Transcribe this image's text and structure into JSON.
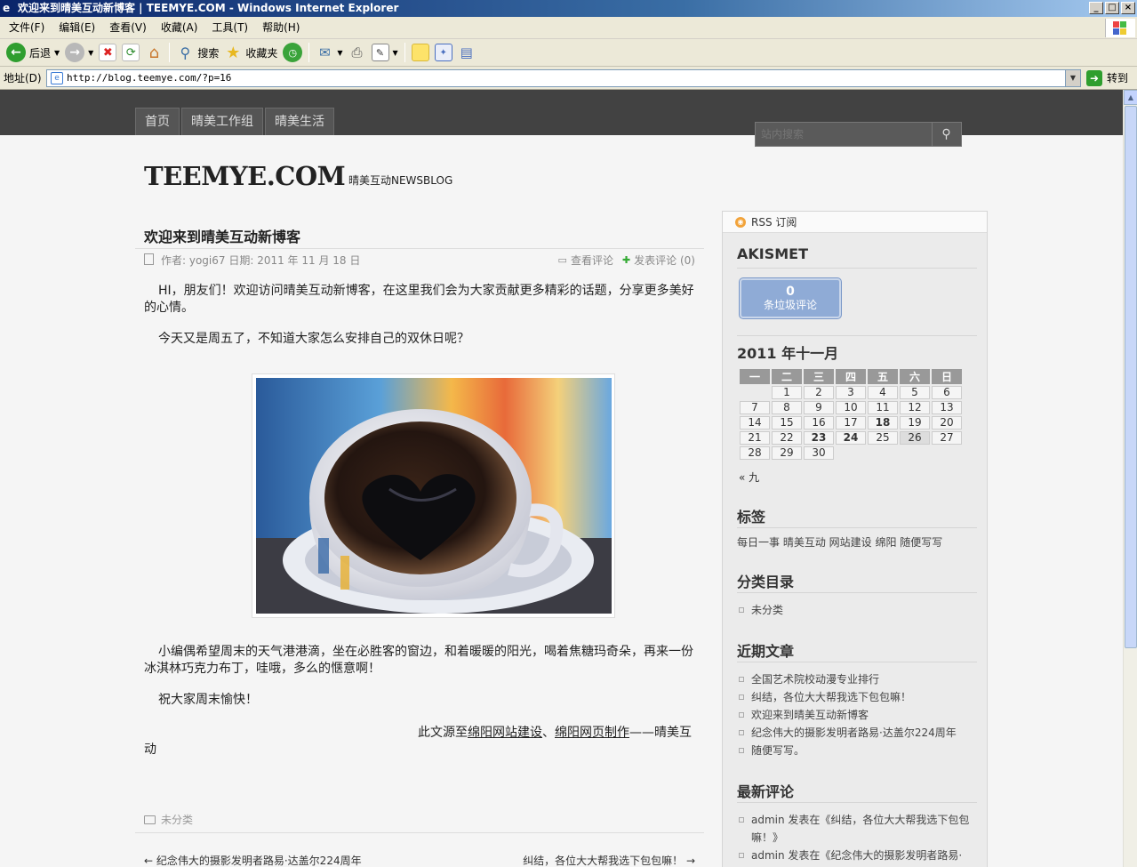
{
  "window": {
    "title": "欢迎来到晴美互动新博客 | TEEMYE.COM - Windows Internet Explorer",
    "buttons": [
      "_",
      "□",
      "×"
    ]
  },
  "menu": [
    "文件(F)",
    "编辑(E)",
    "查看(V)",
    "收藏(A)",
    "工具(T)",
    "帮助(H)"
  ],
  "toolbar": {
    "back": "后退",
    "search": "搜索",
    "favorites": "收藏夹"
  },
  "address": {
    "label": "地址(D)",
    "url": "http://blog.teemye.com/?p=16",
    "go": "转到"
  },
  "site": {
    "nav": [
      "首页",
      "晴美工作组",
      "晴美生活"
    ],
    "search_placeholder": "站内搜索",
    "title": "TEEMYE.COM",
    "description": "晴美互动NEWSBLOG"
  },
  "post": {
    "title": "欢迎来到晴美互动新博客",
    "meta": "作者: yogi67 日期: 2011 年 11 月 18 日",
    "view_comments": "查看评论",
    "add_comment": "发表评论 (0)",
    "p1": "HI，朋友们！欢迎访问晴美互动新博客，在这里我们会为大家贡献更多精彩的话题，分享更多美好的心情。",
    "p2": "今天又是周五了，不知道大家怎么安排自己的双休日呢？",
    "p3": "小编偶希望周末的天气港港滴，坐在必胜客的窗边，和着暖暖的阳光，喝着焦糖玛奇朵，再来一份冰淇林巧克力布丁，哇哦，多么的惬意啊！",
    "p4": "祝大家周末愉快！",
    "source_prefix": "此文源至",
    "source_link1": "绵阳网站建设",
    "source_sep": "、",
    "source_link2": "绵阳网页制作",
    "source_suffix": "——晴美互动",
    "category": "未分类",
    "prev": "← 纪念伟大的摄影发明者路易·达盖尔224周年",
    "next": "纠结，各位大大帮我选下包包嘛！ →"
  },
  "sidebar": {
    "rss": "RSS 订阅",
    "akismet_title": "AKISMET",
    "akismet_count": "0",
    "akismet_label": "条垃圾评论",
    "calendar_title": "2011 年十一月",
    "weekdays": [
      "一",
      "二",
      "三",
      "四",
      "五",
      "六",
      "日"
    ],
    "weeks": [
      [
        "",
        "1",
        "2",
        "3",
        "4",
        "5",
        "6"
      ],
      [
        "7",
        "8",
        "9",
        "10",
        "11",
        "12",
        "13"
      ],
      [
        "14",
        "15",
        "16",
        "17",
        "18",
        "19",
        "20"
      ],
      [
        "21",
        "22",
        "23",
        "24",
        "25",
        "26",
        "27"
      ],
      [
        "28",
        "29",
        "30",
        "",
        "",
        "",
        ""
      ]
    ],
    "calendar_prev": "« 九",
    "tags_title": "标签",
    "tags": "每日一事 晴美互动 网站建设 绵阳 随便写写",
    "categories_title": "分类目录",
    "categories": [
      "未分类"
    ],
    "recent_title": "近期文章",
    "recent": [
      "全国艺术院校动漫专业排行",
      "纠结，各位大大帮我选下包包嘛！",
      "欢迎来到晴美互动新博客",
      "纪念伟大的摄影发明者路易·达盖尔224周年",
      "随便写写。"
    ],
    "comments_title": "最新评论",
    "comments": [
      "admin 发表在《纠结，各位大大帮我选下包包嘛！》",
      "admin 发表在《纪念伟大的摄影发明者路易·达"
    ]
  }
}
